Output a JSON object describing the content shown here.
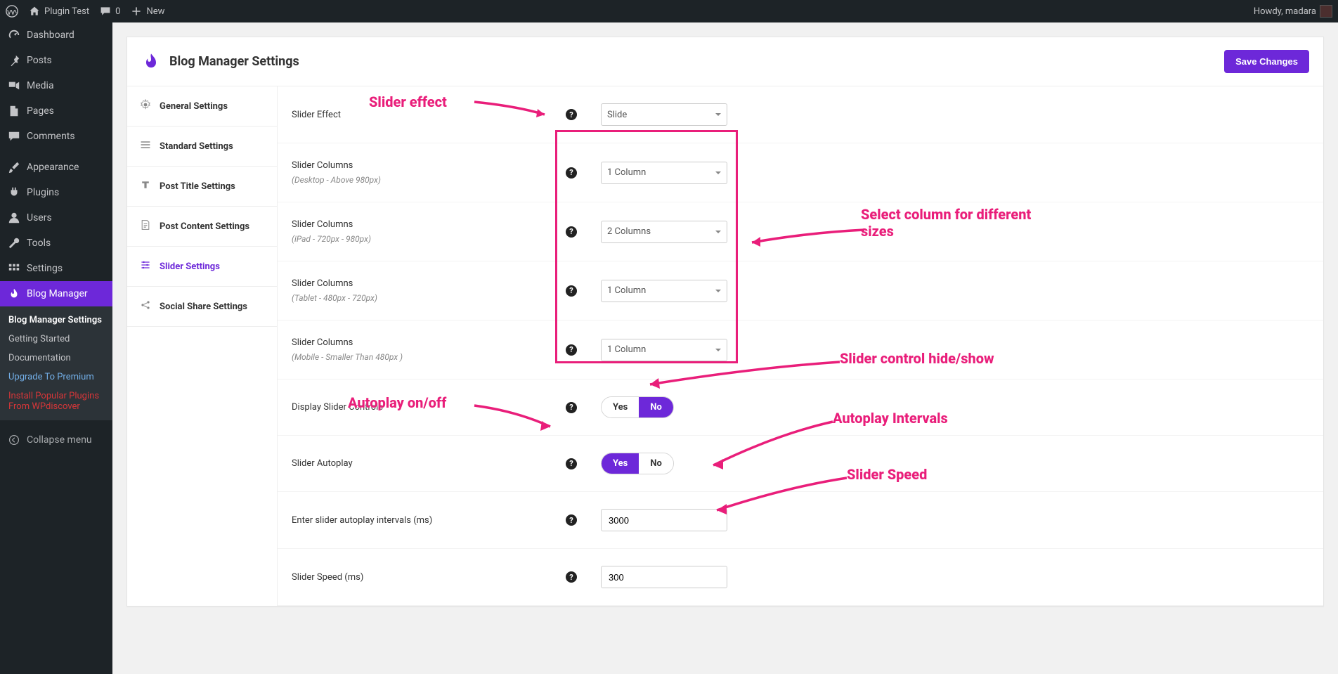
{
  "adminbar": {
    "site_name": "Plugin Test",
    "comments_count": "0",
    "new_label": "New",
    "greeting": "Howdy, madara"
  },
  "sidebar": {
    "items": [
      {
        "label": "Dashboard",
        "icon": "gauge"
      },
      {
        "label": "Posts",
        "icon": "pin"
      },
      {
        "label": "Media",
        "icon": "media"
      },
      {
        "label": "Pages",
        "icon": "page"
      },
      {
        "label": "Comments",
        "icon": "comment"
      },
      {
        "label": "Appearance",
        "icon": "brush"
      },
      {
        "label": "Plugins",
        "icon": "plug"
      },
      {
        "label": "Users",
        "icon": "user"
      },
      {
        "label": "Tools",
        "icon": "wrench"
      },
      {
        "label": "Settings",
        "icon": "settings"
      },
      {
        "label": "Blog Manager",
        "icon": "flame",
        "active": true
      }
    ],
    "submenu": [
      {
        "label": "Blog Manager Settings",
        "cls": "current"
      },
      {
        "label": "Getting Started",
        "cls": ""
      },
      {
        "label": "Documentation",
        "cls": ""
      },
      {
        "label": "Upgrade To Premium",
        "cls": "blue"
      },
      {
        "label": "Install Popular Plugins From WPdiscover",
        "cls": "red"
      }
    ],
    "collapse": "Collapse menu"
  },
  "page": {
    "title": "Blog Manager Settings",
    "save_label": "Save Changes"
  },
  "tabs": [
    {
      "label": "General Settings",
      "icon": "gear"
    },
    {
      "label": "Standard Settings",
      "icon": "stack"
    },
    {
      "label": "Post Title Settings",
      "icon": "title"
    },
    {
      "label": "Post Content Settings",
      "icon": "doc"
    },
    {
      "label": "Slider Settings",
      "icon": "sliders",
      "active": true
    },
    {
      "label": "Social Share Settings",
      "icon": "share"
    }
  ],
  "settings": {
    "effect": {
      "label": "Slider Effect",
      "value": "Slide"
    },
    "cols_desktop": {
      "label": "Slider Columns",
      "sub": "(Desktop - Above 980px)",
      "value": "1 Column"
    },
    "cols_ipad": {
      "label": "Slider Columns",
      "sub": "(iPad - 720px - 980px)",
      "value": "2 Columns"
    },
    "cols_tablet": {
      "label": "Slider Columns",
      "sub": "(Tablet - 480px - 720px)",
      "value": "1 Column"
    },
    "cols_mobile": {
      "label": "Slider Columns",
      "sub": "(Mobile - Smaller Than 480px )",
      "value": "1 Column"
    },
    "controls": {
      "label": "Display Slider Controls",
      "yes": "Yes",
      "no": "No",
      "value": "No"
    },
    "autoplay": {
      "label": "Slider Autoplay",
      "yes": "Yes",
      "no": "No",
      "value": "Yes"
    },
    "intervals": {
      "label": "Enter slider autoplay intervals (ms)",
      "value": "3000"
    },
    "speed": {
      "label": "Slider Speed (ms)",
      "value": "300"
    }
  },
  "annotations": {
    "slider_effect": "Slider effect",
    "col_sizes": "Select column for different sizes",
    "controls": "Slider control hide/show",
    "autoplay": "Autoplay on/off",
    "intervals": "Autoplay Intervals",
    "speed": "Slider Speed"
  }
}
